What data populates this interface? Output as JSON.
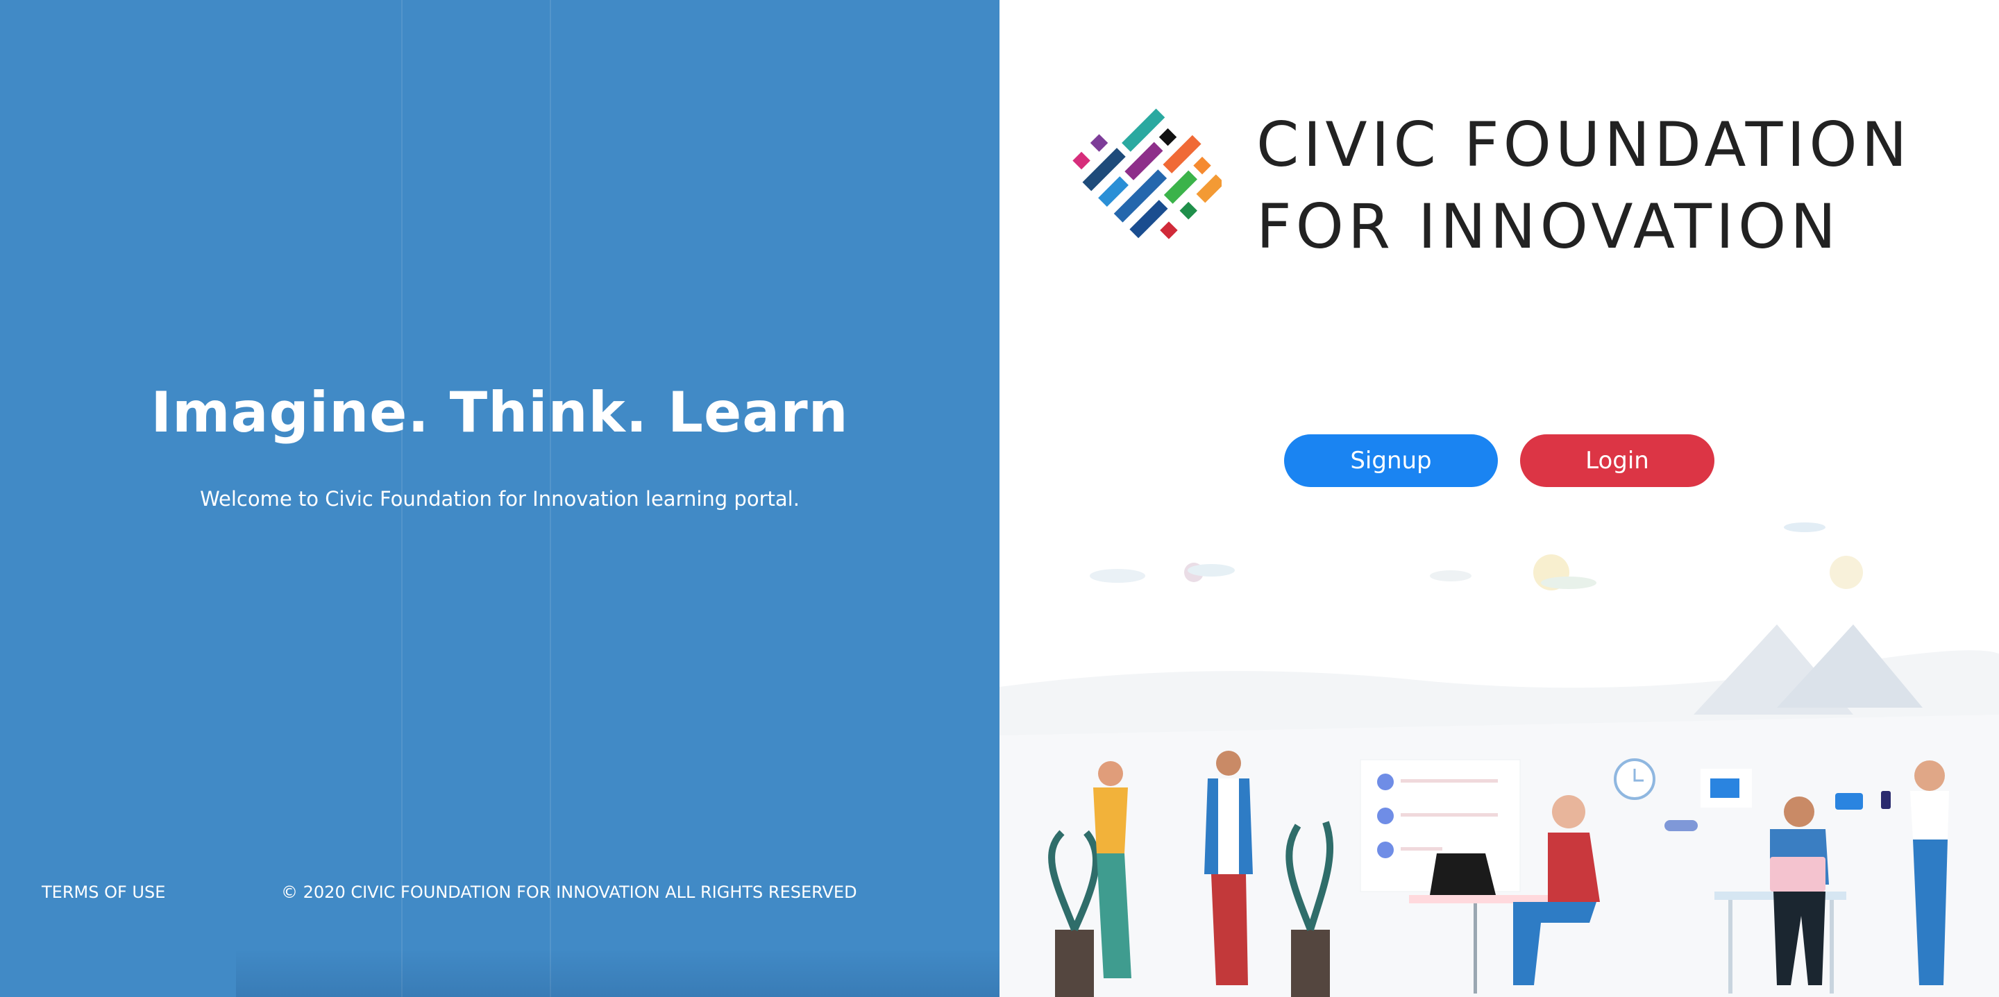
{
  "left_panel": {
    "title": "Imagine. Think. Learn",
    "subtitle": "Welcome to Civic Foundation for Innovation learning portal.",
    "terms_link": "TERMS OF USE",
    "copyright": "© 2020 CIVIC FOUNDATION FOR INNOVATION ALL RIGHTS RESERVED"
  },
  "logo": {
    "line1": "CIVIC FOUNDATION",
    "line2": "FOR INNOVATION"
  },
  "actions": {
    "signup_label": "Signup",
    "login_label": "Login"
  },
  "colors": {
    "left_panel_bg": "#418ac6",
    "signup_button": "#1a84f2",
    "login_button": "#dc3545"
  },
  "icons": [
    "logo-mark-icon",
    "checkbox-check-icon",
    "clock-icon",
    "mail-icon",
    "chat-bubble-icon"
  ]
}
